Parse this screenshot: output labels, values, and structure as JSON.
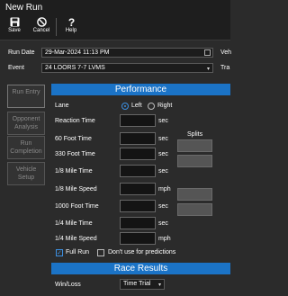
{
  "window": {
    "title": "New Run"
  },
  "toolbar": {
    "save_label": "Save",
    "cancel_label": "Cancel",
    "help_label": "Help"
  },
  "form": {
    "run_date_label": "Run Date",
    "run_date_value": "29-Mar-2024 11:13 PM",
    "event_label": "Event",
    "event_value": "24 LOORS 7-7 LVMS",
    "right_clip_1": "Veh",
    "right_clip_2": "Tra"
  },
  "nav": {
    "run_entry": "Run Entry",
    "opponent_analysis": "Opponent Analysis",
    "run_completion": "Run Completion",
    "vehicle_setup": "Vehicle Setup"
  },
  "performance": {
    "header": "Performance",
    "lane_label": "Lane",
    "lane_left": "Left",
    "lane_right": "Right",
    "splits_label": "Splits",
    "rows": [
      {
        "label": "Reaction Time",
        "unit": "sec"
      },
      {
        "label": "60 Foot Time",
        "unit": "sec"
      },
      {
        "label": "330 Foot Time",
        "unit": "sec"
      },
      {
        "label": "1/8 Mile Time",
        "unit": "sec"
      },
      {
        "label": "1/8 Mile Speed",
        "unit": "mph"
      },
      {
        "label": "1000 Foot Time",
        "unit": "sec"
      },
      {
        "label": "1/4 Mile Time",
        "unit": "sec"
      },
      {
        "label": "1/4 Mile Speed",
        "unit": "mph"
      }
    ],
    "full_run_label": "Full Run",
    "full_run_checked": true,
    "dont_use_label": "Don't use for predictions",
    "dont_use_checked": false
  },
  "race_results": {
    "header": "Race Results",
    "win_loss_label": "Win/Loss",
    "win_loss_value": "Time Trial"
  },
  "colors": {
    "accent": "#1b73c6",
    "background": "#2b2b2b"
  }
}
